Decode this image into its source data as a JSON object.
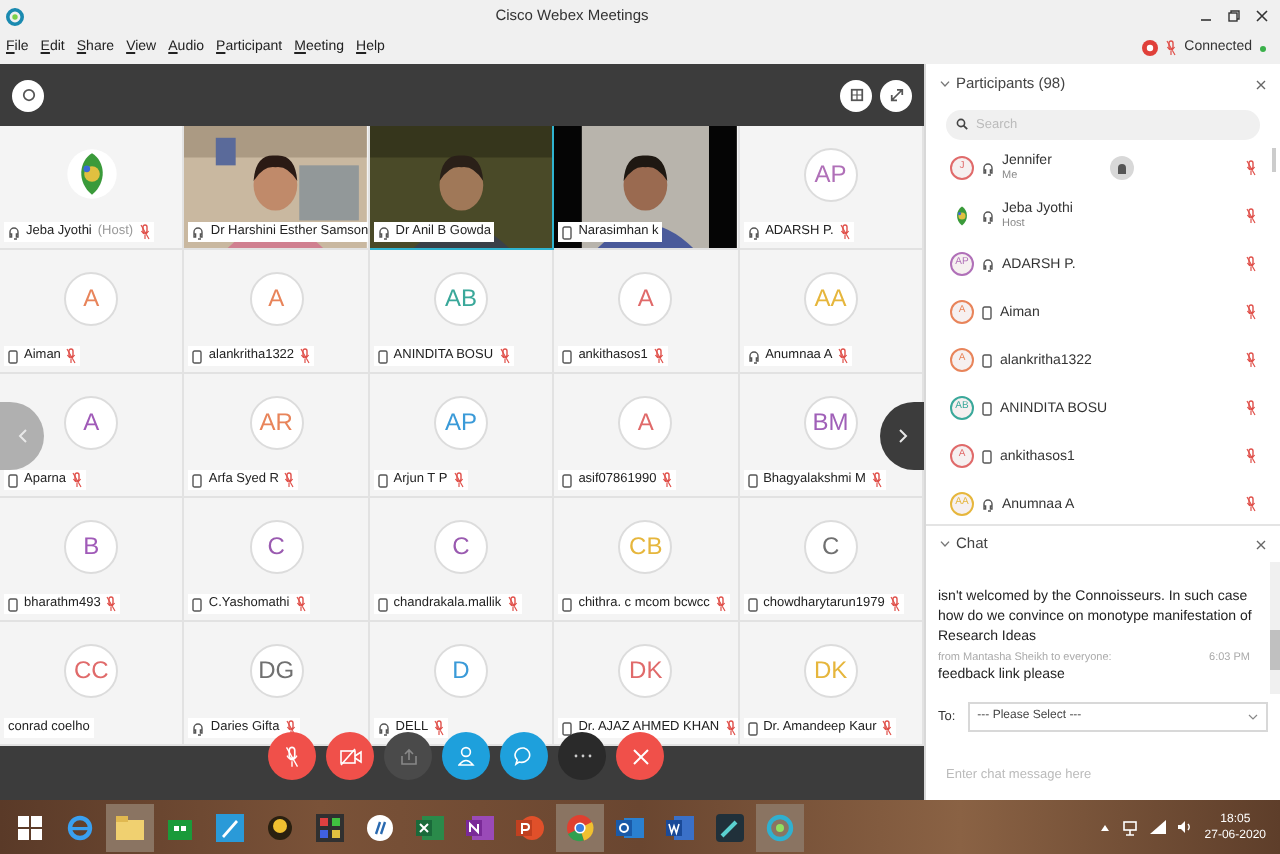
{
  "window": {
    "title": "Cisco Webex Meetings"
  },
  "menu": [
    "File",
    "Edit",
    "Share",
    "View",
    "Audio",
    "Participant",
    "Meeting",
    "Help"
  ],
  "status": {
    "text": "Connected"
  },
  "tiles": [
    {
      "kind": "logo",
      "name": "Jeba Jyothi",
      "role": "(Host)",
      "phone": false,
      "muted": true,
      "speaking": false
    },
    {
      "kind": "video",
      "name": "Dr Harshini Esther Samson",
      "phone": false,
      "muted": false,
      "speaking": false
    },
    {
      "kind": "video",
      "name": "Dr Anil B Gowda",
      "phone": false,
      "muted": false,
      "speaking": true
    },
    {
      "kind": "video",
      "name": "Narasimhan k",
      "phone": true,
      "muted": false,
      "speaking": false
    },
    {
      "kind": "avatar",
      "initials": "AP",
      "color": "#b070b8",
      "name": "ADARSH P.",
      "phone": false,
      "muted": true,
      "speaking": false
    },
    {
      "kind": "avatar",
      "initials": "A",
      "color": "#e8845a",
      "name": "Aiman",
      "phone": true,
      "muted": true,
      "speaking": false
    },
    {
      "kind": "avatar",
      "initials": "A",
      "color": "#e8845a",
      "name": "alankritha1322",
      "phone": true,
      "muted": true,
      "speaking": false
    },
    {
      "kind": "avatar",
      "initials": "AB",
      "color": "#3aa89a",
      "name": "ANINDITA BOSU",
      "phone": true,
      "muted": true,
      "speaking": false
    },
    {
      "kind": "avatar",
      "initials": "A",
      "color": "#e06a6a",
      "name": "ankithasos1",
      "phone": true,
      "muted": true,
      "speaking": false
    },
    {
      "kind": "avatar",
      "initials": "AA",
      "color": "#e6b63c",
      "name": "Anumnaa A",
      "phone": false,
      "muted": true,
      "speaking": false
    },
    {
      "kind": "avatar",
      "initials": "A",
      "color": "#a05ab8",
      "name": "Aparna",
      "phone": true,
      "muted": true,
      "speaking": false
    },
    {
      "kind": "avatar",
      "initials": "AR",
      "color": "#e8845a",
      "name": "Arfa Syed R",
      "phone": true,
      "muted": true,
      "speaking": false
    },
    {
      "kind": "avatar",
      "initials": "AP",
      "color": "#3a9ad8",
      "name": "Arjun T P",
      "phone": true,
      "muted": true,
      "speaking": false
    },
    {
      "kind": "avatar",
      "initials": "A",
      "color": "#e06a6a",
      "name": "asif07861990",
      "phone": true,
      "muted": true,
      "speaking": false
    },
    {
      "kind": "avatar",
      "initials": "BM",
      "color": "#a060b8",
      "name": "Bhagyalakshmi M",
      "phone": true,
      "muted": true,
      "speaking": false
    },
    {
      "kind": "avatar",
      "initials": "B",
      "color": "#a05ab8",
      "name": "bharathm493",
      "phone": true,
      "muted": true,
      "speaking": false
    },
    {
      "kind": "avatar",
      "initials": "C",
      "color": "#9a5ab0",
      "name": "C.Yashomathi",
      "phone": true,
      "muted": true,
      "speaking": false
    },
    {
      "kind": "avatar",
      "initials": "C",
      "color": "#9a5ab0",
      "name": "chandrakala.mallik",
      "phone": true,
      "muted": true,
      "speaking": false
    },
    {
      "kind": "avatar",
      "initials": "CB",
      "color": "#e6b63c",
      "name": "chithra. c mcom bcwcc",
      "phone": true,
      "muted": true,
      "speaking": false
    },
    {
      "kind": "avatar",
      "initials": "C",
      "color": "#707070",
      "name": "chowdharytarun1979",
      "phone": true,
      "muted": true,
      "speaking": false
    },
    {
      "kind": "avatar",
      "initials": "CC",
      "color": "#e06a6a",
      "name": "conrad coelho",
      "muted": false,
      "speaking": false
    },
    {
      "kind": "avatar",
      "initials": "DG",
      "color": "#707070",
      "name": "Daries Gifta",
      "phone": false,
      "muted": true,
      "speaking": false
    },
    {
      "kind": "avatar",
      "initials": "D",
      "color": "#3a9ad8",
      "name": "DELL",
      "phone": false,
      "muted": true,
      "speaking": false
    },
    {
      "kind": "avatar",
      "initials": "DK",
      "color": "#e06a6a",
      "name": "Dr. AJAZ AHMED KHAN",
      "phone": true,
      "muted": true,
      "speaking": false
    },
    {
      "kind": "avatar",
      "initials": "DK",
      "color": "#e6b63c",
      "name": "Dr. Amandeep Kaur",
      "phone": true,
      "muted": true,
      "speaking": false
    }
  ],
  "participants": {
    "title": "Participants (98)",
    "search": {
      "placeholder": "Search"
    },
    "items": [
      {
        "kind": "initials",
        "initials": "J",
        "color": "#e06a6a",
        "phone": false,
        "name": "Jennifer",
        "subtitle": "Me",
        "muted": true,
        "hand_raised": true
      },
      {
        "kind": "logo",
        "phone": false,
        "name": "Jeba Jyothi",
        "subtitle": "Host",
        "muted": true,
        "hand_raised": false
      },
      {
        "kind": "initials",
        "initials": "AP",
        "color": "#b070b8",
        "phone": false,
        "name": "ADARSH P.",
        "muted": true,
        "hand_raised": false
      },
      {
        "kind": "initials",
        "initials": "A",
        "color": "#e8845a",
        "phone": true,
        "name": "Aiman",
        "muted": true,
        "hand_raised": false
      },
      {
        "kind": "initials",
        "initials": "A",
        "color": "#e8845a",
        "phone": true,
        "name": "alankritha1322",
        "muted": true,
        "hand_raised": false
      },
      {
        "kind": "initials",
        "initials": "AB",
        "color": "#3aa89a",
        "phone": true,
        "name": "ANINDITA BOSU",
        "muted": true,
        "hand_raised": false
      },
      {
        "kind": "initials",
        "initials": "A",
        "color": "#e06a6a",
        "phone": true,
        "name": "ankithasos1",
        "muted": true,
        "hand_raised": false
      },
      {
        "kind": "initials",
        "initials": "AA",
        "color": "#e6b63c",
        "phone": false,
        "name": "Anumnaa A",
        "muted": true,
        "hand_raised": false
      }
    ]
  },
  "chat": {
    "title": "Chat",
    "messages": [
      {
        "text": "isn't welcomed by the Connoisseurs. In such case how do we convince on monotype manifestation of Research Ideas"
      },
      {
        "sender": "from Mantasha Sheikh to everyone:",
        "time": "6:03 PM",
        "text": "feedback link please"
      }
    ],
    "to_label": "To:",
    "to_value": "--- Please Select ---",
    "input": {
      "placeholder": "Enter chat message here"
    }
  },
  "taskbar": {
    "time": "18:05",
    "date": "27-06-2020"
  }
}
